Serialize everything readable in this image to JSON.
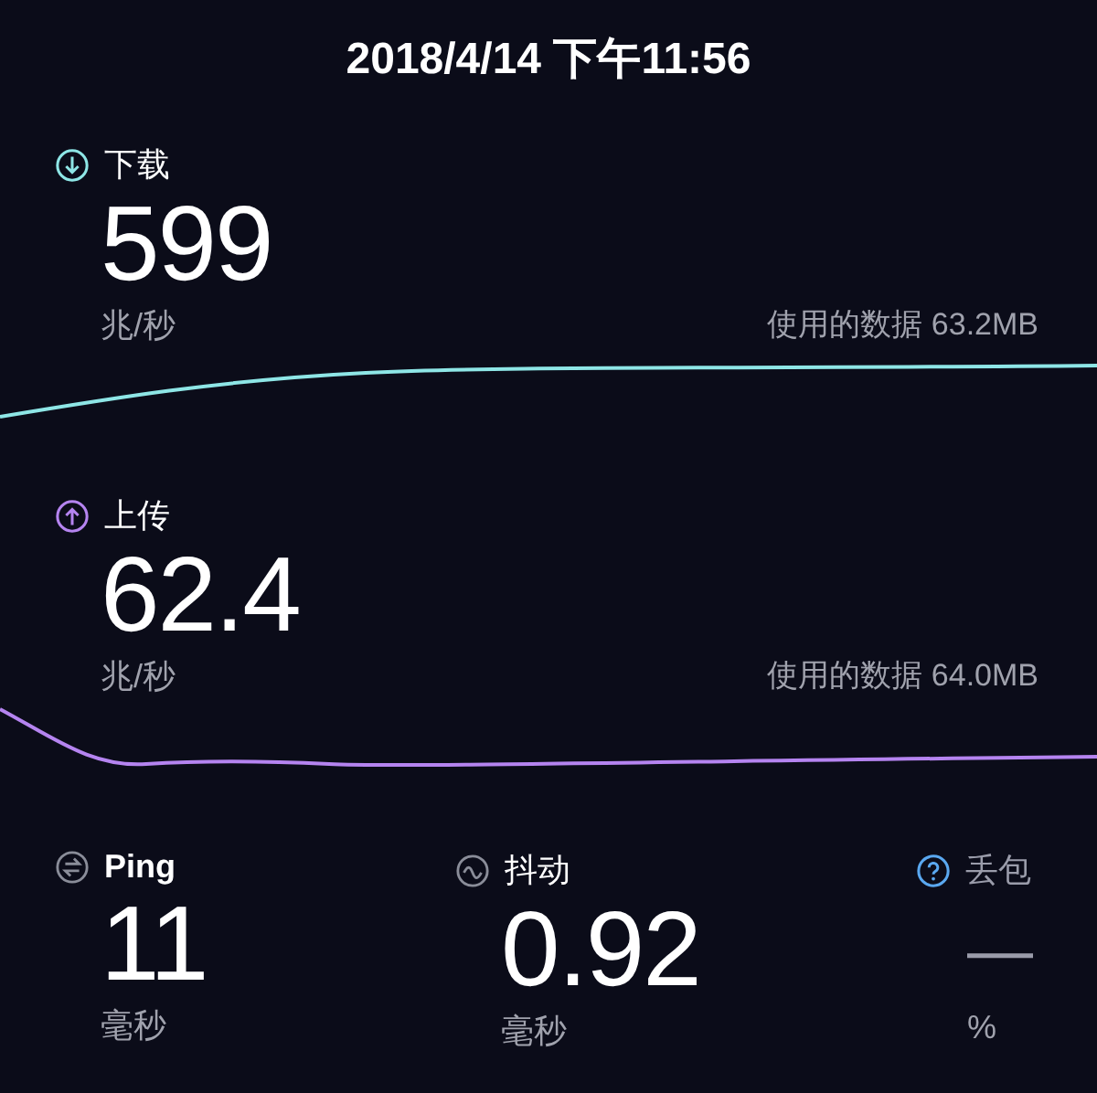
{
  "timestamp": "2018/4/14 下午11:56",
  "tests": [
    {
      "kind": "download",
      "label": "下载",
      "color": "#8ee6e6",
      "value": "599",
      "unit": "兆/秒",
      "data_used": "使用的数据 63.2MB"
    },
    {
      "kind": "upload",
      "label": "上传",
      "color": "#b584f0",
      "value": "62.4",
      "unit": "兆/秒",
      "data_used": "使用的数据 64.0MB"
    }
  ],
  "metrics": [
    {
      "kind": "ping",
      "label": "Ping",
      "available": true,
      "value": "11",
      "unit": "毫秒"
    },
    {
      "kind": "jitter",
      "label": "抖动",
      "available": true,
      "value": "0.92",
      "unit": "毫秒"
    },
    {
      "kind": "packet_loss",
      "label": "丢包",
      "available": false,
      "value": "—",
      "unit": "%"
    }
  ]
}
